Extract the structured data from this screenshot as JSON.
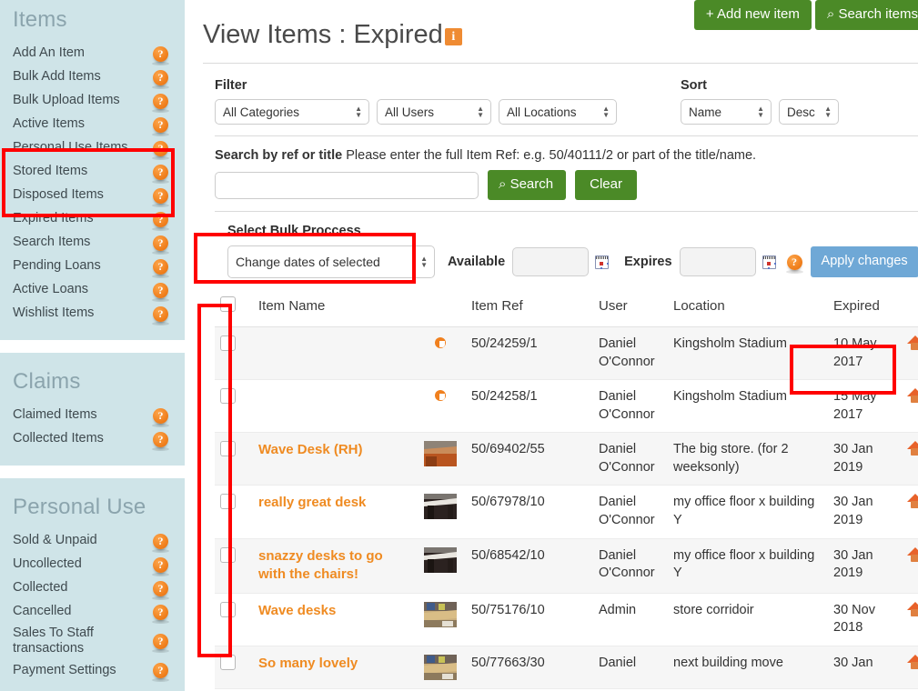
{
  "sidebar": {
    "panels": [
      {
        "title": "Items",
        "items": [
          {
            "label": "Add An Item",
            "help": "?"
          },
          {
            "label": "Bulk Add Items",
            "help": "?"
          },
          {
            "label": "Bulk Upload Items",
            "help": "?"
          },
          {
            "label": "Active Items",
            "help": "?"
          },
          {
            "label": "Personal Use Items",
            "help": "?"
          },
          {
            "label": "Stored Items",
            "help": "?"
          },
          {
            "label": "Disposed Items",
            "help": "?"
          },
          {
            "label": "Expired Items",
            "help": "?"
          },
          {
            "label": "Search Items",
            "help": "?"
          },
          {
            "label": "Pending Loans",
            "help": "?"
          },
          {
            "label": "Active Loans",
            "help": "?"
          },
          {
            "label": "Wishlist Items",
            "help": "?"
          }
        ]
      },
      {
        "title": "Claims",
        "items": [
          {
            "label": "Claimed Items",
            "help": "?"
          },
          {
            "label": "Collected Items",
            "help": "?"
          }
        ]
      },
      {
        "title": "Personal Use",
        "items": [
          {
            "label": "Sold & Unpaid",
            "help": "?"
          },
          {
            "label": "Uncollected",
            "help": "?"
          },
          {
            "label": "Collected",
            "help": "?"
          },
          {
            "label": "Cancelled",
            "help": "?"
          },
          {
            "label": "Sales To Staff transactions",
            "help": "?"
          },
          {
            "label": "Payment Settings",
            "help": "?"
          }
        ]
      }
    ]
  },
  "header": {
    "title": "View Items : Expired",
    "info_badge": "i",
    "add_new_item": "+  Add new item",
    "search_items": "⌕  Search items"
  },
  "filter": {
    "label": "Filter",
    "category": "All Categories",
    "user": "All Users",
    "location": "All Locations"
  },
  "sort": {
    "label": "Sort",
    "field": "Name",
    "direction": "Desc"
  },
  "search": {
    "label": "Search by ref or title",
    "hint": "Please enter the full Item Ref: e.g. 50/40111/2 or part of the title/name.",
    "value": "",
    "placeholder": "",
    "search_button": "⌕  Search",
    "clear_button": "Clear"
  },
  "bulk": {
    "label": "Select Bulk Proccess",
    "process": "Change dates of selected",
    "available_label": "Available",
    "available_value": "",
    "expires_label": "Expires",
    "expires_value": "",
    "help": "?",
    "apply_button": "Apply changes"
  },
  "table": {
    "columns": [
      "",
      "Item Name",
      "",
      "Item Ref",
      "User",
      "Location",
      "Expired"
    ],
    "rows": [
      {
        "name": "",
        "thumb": "placeholder",
        "ref": "50/24259/1",
        "user": "Daniel O'Connor",
        "location": "Kingsholm Stadium",
        "expired": "10 May 2017"
      },
      {
        "name": "",
        "thumb": "placeholder",
        "ref": "50/24258/1",
        "user": "Daniel O'Connor",
        "location": "Kingsholm Stadium",
        "expired": "15 May 2017"
      },
      {
        "name": "Wave Desk (RH)",
        "thumb": "desk-orange",
        "ref": "50/69402/55",
        "user": "Daniel O'Connor",
        "location": "The big store. (for 2 weeksonly)",
        "expired": "30 Jan 2019"
      },
      {
        "name": "really great desk",
        "thumb": "desk-dark",
        "ref": "50/67978/10",
        "user": "Daniel O'Connor",
        "location": "my office floor x building Y",
        "expired": "30 Jan 2019"
      },
      {
        "name": "snazzy desks to go with the chairs!",
        "thumb": "desk-dark",
        "ref": "50/68542/10",
        "user": "Daniel O'Connor",
        "location": "my office floor x building Y",
        "expired": "30 Jan 2019"
      },
      {
        "name": "Wave desks",
        "thumb": "desk-light",
        "ref": "50/75176/10",
        "user": "Admin",
        "location": "store corridoir",
        "expired": "30 Nov 2018"
      },
      {
        "name": "So many lovely",
        "thumb": "desk-light",
        "ref": "50/77663/30",
        "user": "Daniel",
        "location": "next building move",
        "expired": "30 Jan"
      }
    ]
  },
  "colors": {
    "sidebar_bg": "#cfe4e8",
    "green_button": "#4b8a27",
    "orange_accent": "#ef8b22",
    "blue_button": "#6fa8d6",
    "annotation_red": "#ff0000"
  }
}
